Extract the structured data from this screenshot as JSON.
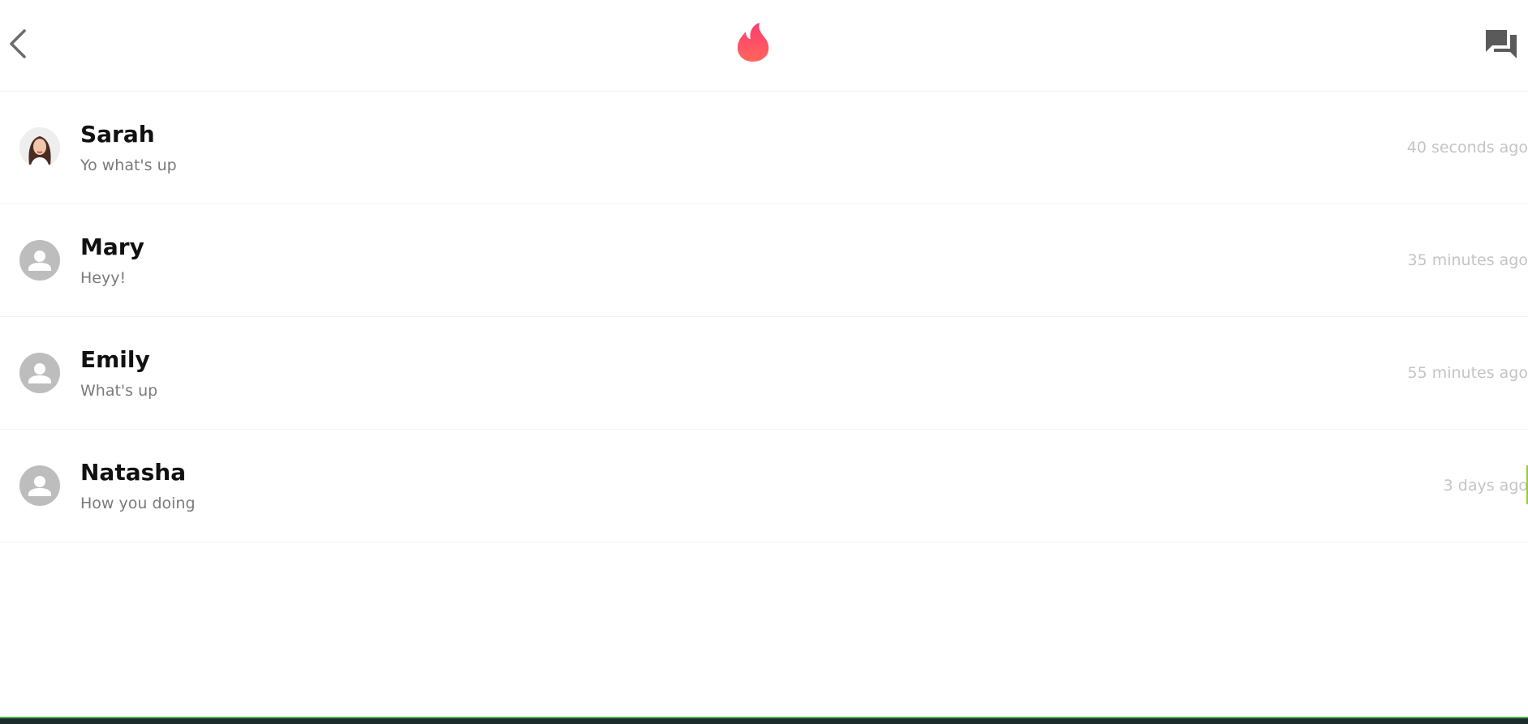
{
  "header": {
    "back_icon": "chevron-left-icon",
    "logo_icon": "flame-logo-icon",
    "messages_icon": "chat-bubbles-icon",
    "brand_color": "#fd5068"
  },
  "conversations": [
    {
      "name": "Sarah",
      "preview": "Yo what's up",
      "time": "40 seconds ago",
      "avatar": "photo"
    },
    {
      "name": "Mary",
      "preview": "Heyy!",
      "time": "35 minutes ago",
      "avatar": "default-user-icon"
    },
    {
      "name": "Emily",
      "preview": "What's up",
      "time": "55 minutes ago",
      "avatar": "default-user-icon"
    },
    {
      "name": "Natasha",
      "preview": "How you doing",
      "time": "3 days ago",
      "avatar": "default-user-icon"
    }
  ]
}
